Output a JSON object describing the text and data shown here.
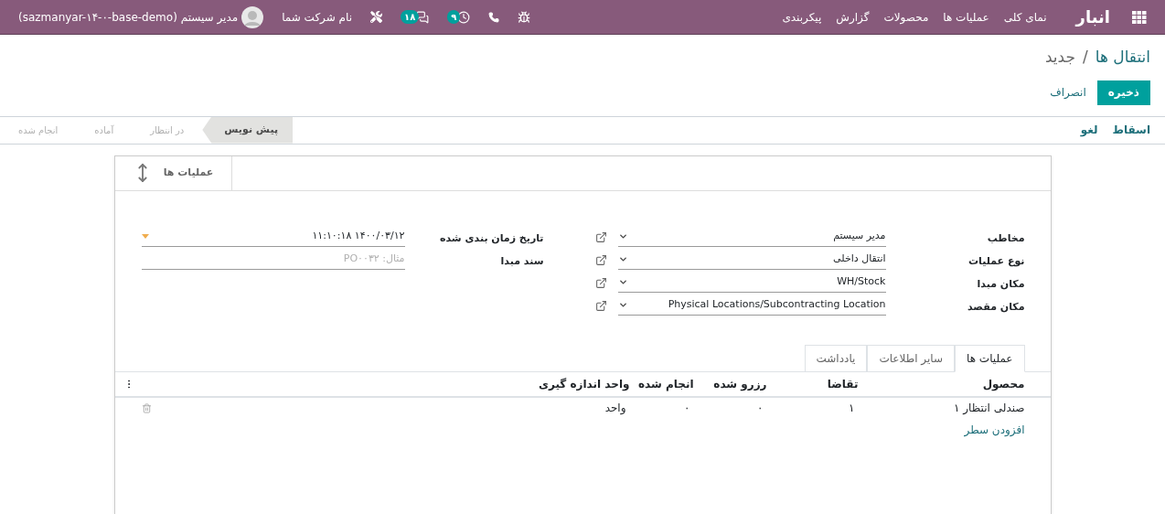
{
  "navbar": {
    "app_name": "انبار",
    "menu": [
      "نمای کلی",
      "عملیات ها",
      "محصولات",
      "گزارش",
      "پیکربندی"
    ],
    "activity_count": "۹",
    "message_count": "۱۸",
    "company": "نام شرکت شما",
    "user": "مدیر سیستم (sazmanyar-۱۴-۰-base-demo)"
  },
  "breadcrumb": {
    "parent": "انتقال ها",
    "separator": "/",
    "current": "جدید"
  },
  "actions": {
    "save": "ذخیره",
    "discard": "انصراف"
  },
  "status_buttons": [
    "اسقاط",
    "لغو"
  ],
  "stages": [
    {
      "label": "پیش نویس",
      "selected": true
    },
    {
      "label": "در انتظار",
      "selected": false
    },
    {
      "label": "آماده",
      "selected": false
    },
    {
      "label": "انجام شده",
      "selected": false
    }
  ],
  "stat_button": {
    "label": "عملیات ها"
  },
  "right_fields": [
    {
      "label": "مخاطب",
      "kind": "select",
      "value": "مدیر سیستم"
    },
    {
      "label": "نوع عملیات",
      "kind": "select",
      "value": "انتقال داخلی"
    },
    {
      "label": "مکان مبدا",
      "kind": "select",
      "value": "WH/Stock"
    },
    {
      "label": "مکان مقصد",
      "kind": "select",
      "value": "Physical Locations/Subcontracting Location"
    }
  ],
  "left_fields": [
    {
      "label": "تاریخ زمان بندی شده",
      "kind": "datetime",
      "value": "۱۴۰۰/۰۳/۱۲ ۱۱:۱۰:۱۸"
    },
    {
      "label": "سند مبدا",
      "kind": "text",
      "placeholder": "مثال: PO۰۰۳۲"
    }
  ],
  "tabs": [
    {
      "label": "عملیات ها",
      "selected": true
    },
    {
      "label": "سایر اطلاعات",
      "selected": false
    },
    {
      "label": "یادداشت",
      "selected": false
    }
  ],
  "table": {
    "columns": [
      "محصول",
      "تقاضا",
      "رزرو شده",
      "انجام شده",
      "واحد اندازه گیری"
    ],
    "rows": [
      [
        "صندلی انتظار ۱",
        "۱",
        "۰",
        "۰",
        "واحد"
      ]
    ],
    "add_line": "افزودن سطر"
  }
}
